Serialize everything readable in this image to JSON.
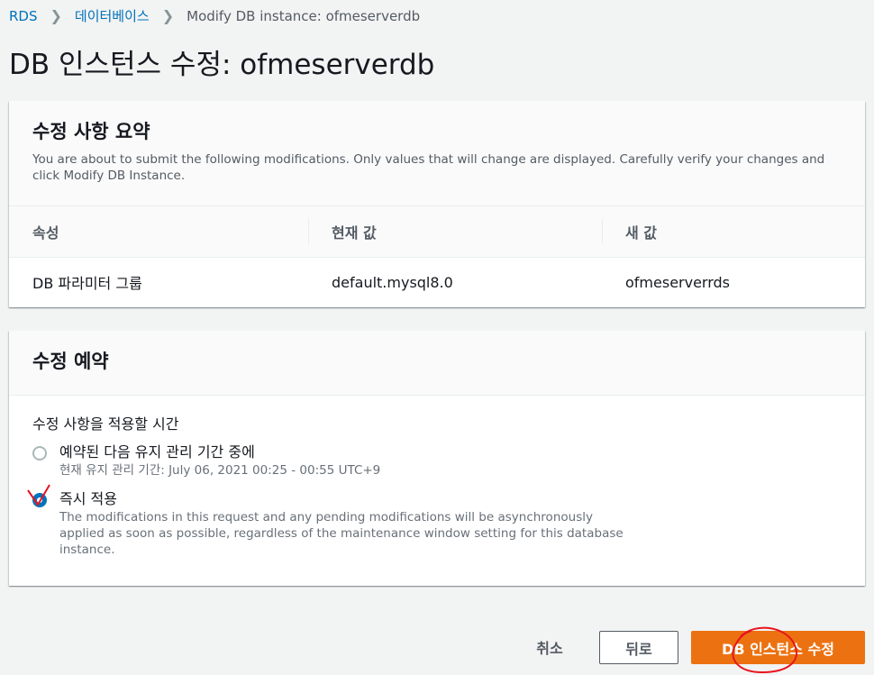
{
  "breadcrumb": {
    "items": [
      "RDS",
      "데이터베이스"
    ],
    "current": "Modify DB instance: ofmeserverdb"
  },
  "page_title": "DB 인스턴스 수정: ofmeserverdb",
  "summary": {
    "title": "수정 사항 요약",
    "description": "You are about to submit the following modifications. Only values that will change are displayed. Carefully verify your changes and click Modify DB Instance.",
    "columns": [
      "속성",
      "현재 값",
      "새 값"
    ],
    "rows": [
      [
        "DB 파라미터 그룹",
        "default.mysql8.0",
        "ofmeserverrds"
      ]
    ]
  },
  "schedule": {
    "title": "수정 예약",
    "field_label": "수정 사항을 적용할 시간",
    "options": [
      {
        "label": "예약된 다음 유지 관리 기간 중에",
        "desc": "현재 유지 관리 기간: July 06, 2021 00:25 - 00:55 UTC+9",
        "selected": false
      },
      {
        "label": "즉시 적용",
        "desc": "The modifications in this request and any pending modifications will be asynchronously applied as soon as possible, regardless of the maintenance window setting for this database instance.",
        "selected": true
      }
    ]
  },
  "footer": {
    "cancel_label": "취소",
    "back_label": "뒤로",
    "submit_label": "DB 인스턴스 수정"
  },
  "colors": {
    "primary": "#ec7211",
    "link": "#0073bb",
    "annotation": "#e8141e"
  }
}
